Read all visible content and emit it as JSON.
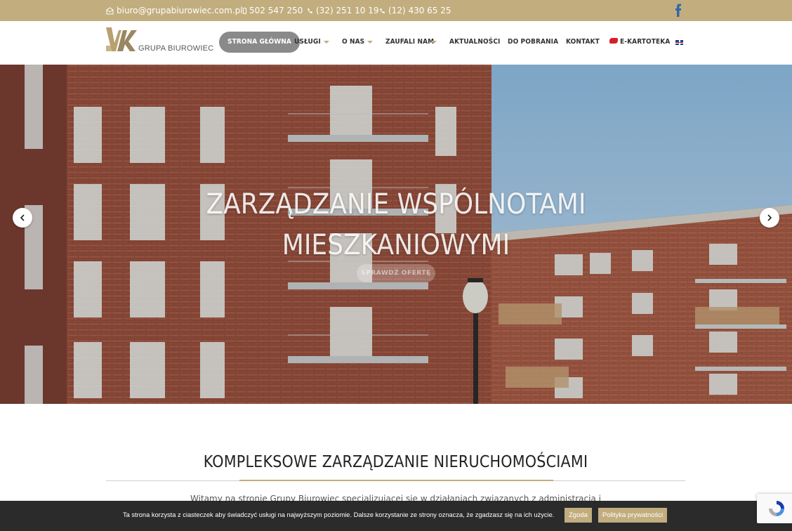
{
  "topbar": {
    "email": "biuro@grupabiurowiec.com.pl",
    "phone_mobile": "502 547 250",
    "phone_1": "(32) 251 10 19",
    "phone_2": "(12) 430 65 25",
    "social_icon": "facebook-icon"
  },
  "header": {
    "logo_text": "GRUPA BIUROWIEC",
    "nav": [
      {
        "label": "STRONA GŁÓWNA",
        "active": true,
        "dropdown": false
      },
      {
        "label": "USŁUGI",
        "active": false,
        "dropdown": true
      },
      {
        "label": "O NAS",
        "active": false,
        "dropdown": true
      },
      {
        "label": "ZAUFALI NAM",
        "active": false,
        "dropdown": true
      },
      {
        "label": "AKTUALNOŚCI",
        "active": false,
        "dropdown": false
      },
      {
        "label": "DO POBRANIA",
        "active": false,
        "dropdown": false
      },
      {
        "label": "KONTAKT",
        "active": false,
        "dropdown": false
      },
      {
        "label": "E-KARTOTEKA",
        "active": false,
        "dropdown": false
      }
    ],
    "language_icon": "uk-flag-icon"
  },
  "hero": {
    "title_line1": "ZARZĄDZANIE WSPÓLNOTAMI",
    "title_line2": "MIESZKANIOWYMI",
    "button_label": "SPRAWDŹ OFERTĘ",
    "prev_icon": "chevron-left-icon",
    "next_icon": "chevron-right-icon"
  },
  "main": {
    "section_title": "KOMPLEKSOWE ZARZĄDZANIE NIERUCHOMOŚCIAMI",
    "intro_text": "Witamy na stronie Grupy Biurowiec specjalizującej się w działaniach związanych z administracją i"
  },
  "cookie_bar": {
    "text": "Ta strona korzysta z ciasteczek aby świadczyć usługi na najwyższym poziomie. Dalsze korzystanie ze strony oznacza, że zgadzasz się na ich użycie.",
    "accept_label": "Zgoda",
    "policy_label": "Polityka prywatności",
    "close_label": "✕"
  },
  "colors": {
    "accent": "#c2ad7e",
    "active_nav": "#8a8a8a",
    "cookie_bg": "#1e1e1e"
  }
}
